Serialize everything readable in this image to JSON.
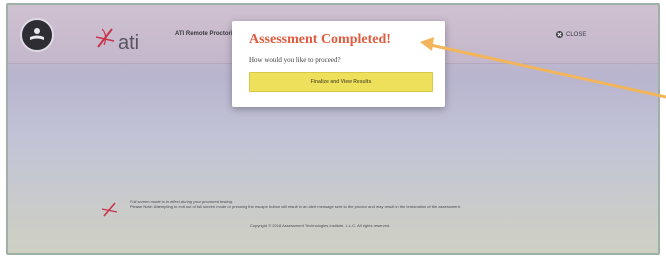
{
  "header": {
    "exam_title": "ATI Remote Proctoring",
    "logo_text": "ati",
    "close_label": "CLOSE"
  },
  "modal": {
    "title": "Assessment Completed!",
    "subtitle": "How would you like to proceed?",
    "finalize_button": "Finalize and View Results"
  },
  "footer": {
    "notice_line1": "Full screen mode is in effect during your proctored testing.",
    "notice_line2": "Please Note: Attempting to exit out of full screen mode or pressing the escape button will result in an alert message sent to the proctor and may result in the termination of the assessment.",
    "copyright": "Copyright © 2018 Assessment Technologies Institute, L.L.C. All rights reserved."
  },
  "colors": {
    "modal_title": "#e05a3e",
    "finalize_button": "#efe05c",
    "arrow": "#f2b55a"
  },
  "icons": [
    "reading-person-icon",
    "ati-pen-logo-icon",
    "close-icon",
    "ati-footer-pen-icon",
    "pointer-arrow"
  ]
}
